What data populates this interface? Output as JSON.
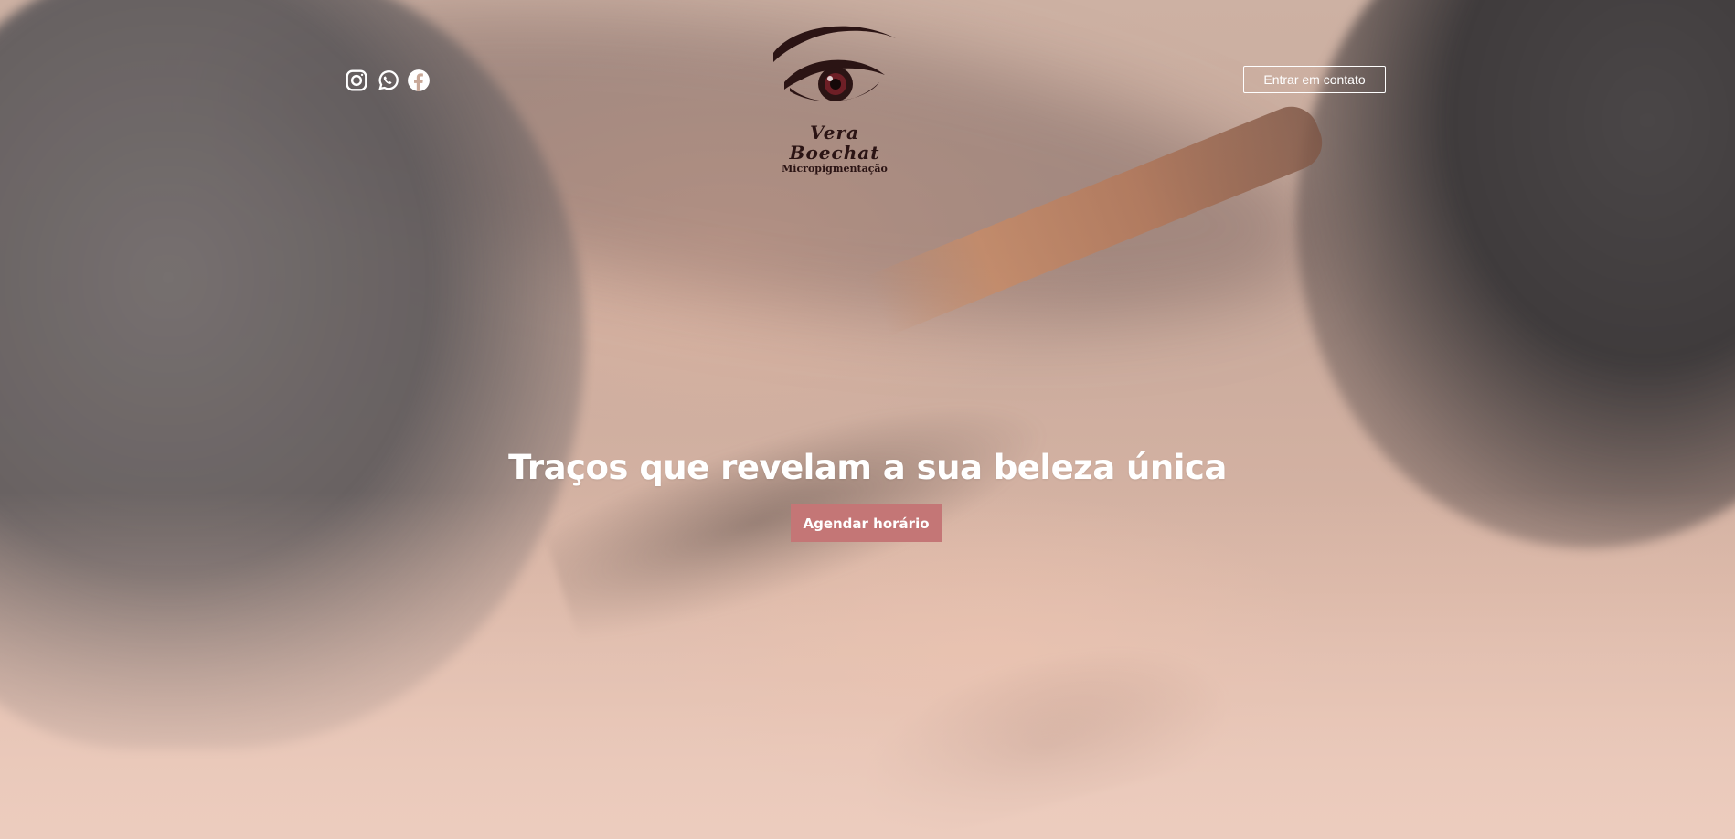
{
  "header": {
    "social": [
      {
        "name": "instagram-icon"
      },
      {
        "name": "whatsapp-icon"
      },
      {
        "name": "facebook-icon"
      }
    ],
    "logo": {
      "name": "Vera Boechat",
      "subtitle": "Micropigmentação"
    },
    "contact_button_label": "Entrar em contato"
  },
  "hero": {
    "headline": "Traços que revelam a sua beleza única",
    "cta_label": "Agendar horário"
  },
  "colors": {
    "cta_background": "#c47676",
    "logo_text": "#2b1414",
    "hero_overlay": "#ecccbd"
  }
}
